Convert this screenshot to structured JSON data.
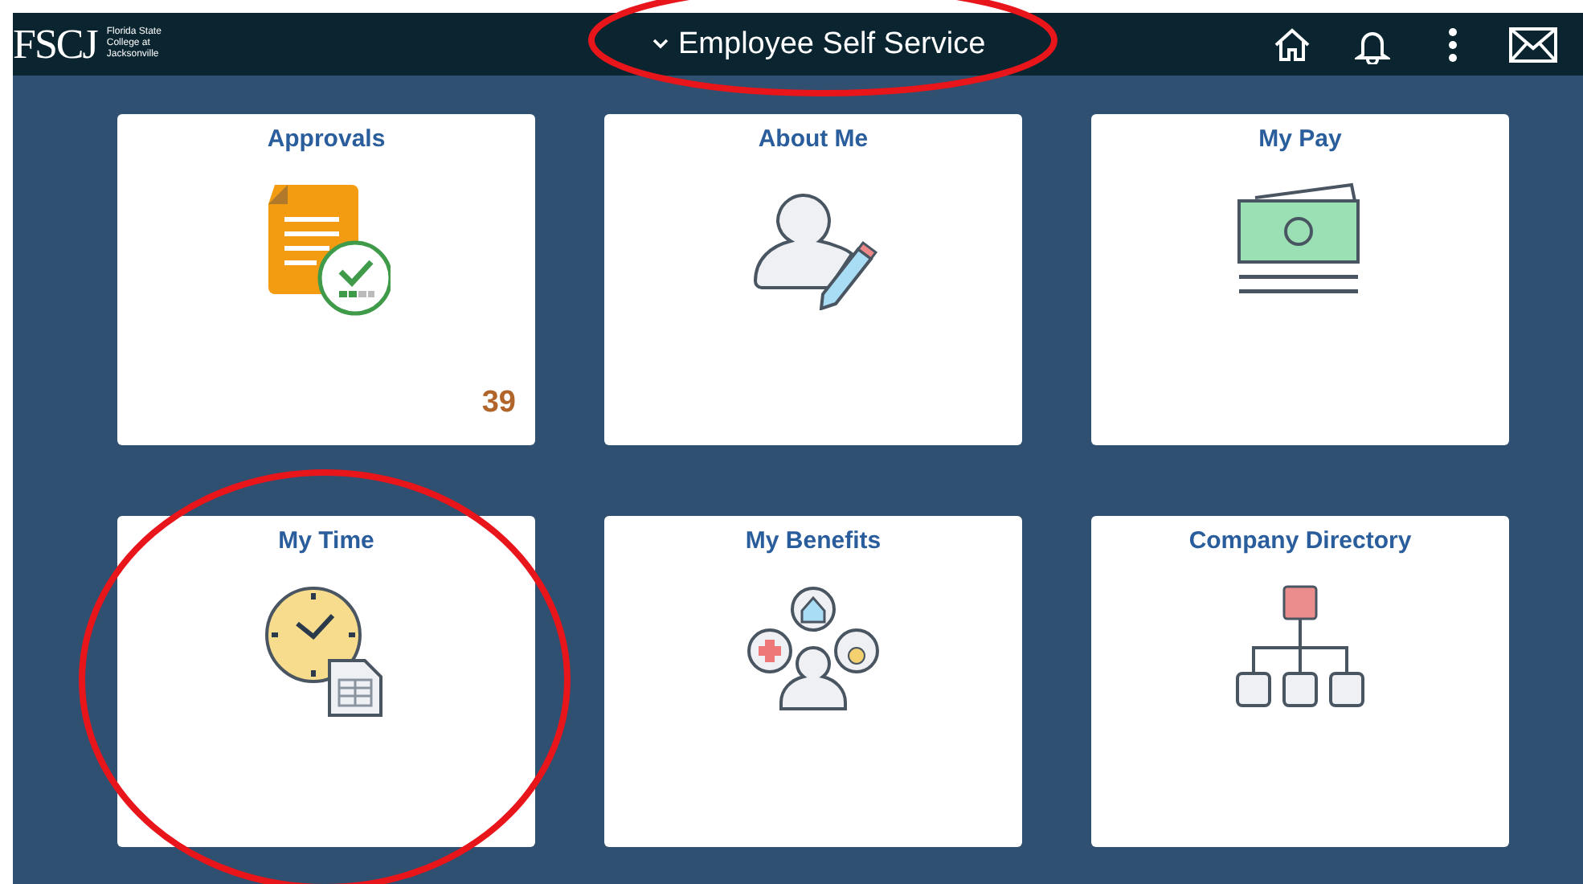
{
  "header": {
    "logo": "FSCJ",
    "logo_subtitle": "Florida State College at Jacksonville",
    "title": "Employee Self Service",
    "title_circled": true
  },
  "tiles": [
    {
      "title": "Approvals",
      "count": "39",
      "circled": false
    },
    {
      "title": "About Me",
      "circled": false
    },
    {
      "title": "My Pay",
      "circled": false
    },
    {
      "title": "My Time",
      "circled": true
    },
    {
      "title": "My Benefits",
      "circled": false
    },
    {
      "title": "Company Directory",
      "circled": false
    }
  ]
}
